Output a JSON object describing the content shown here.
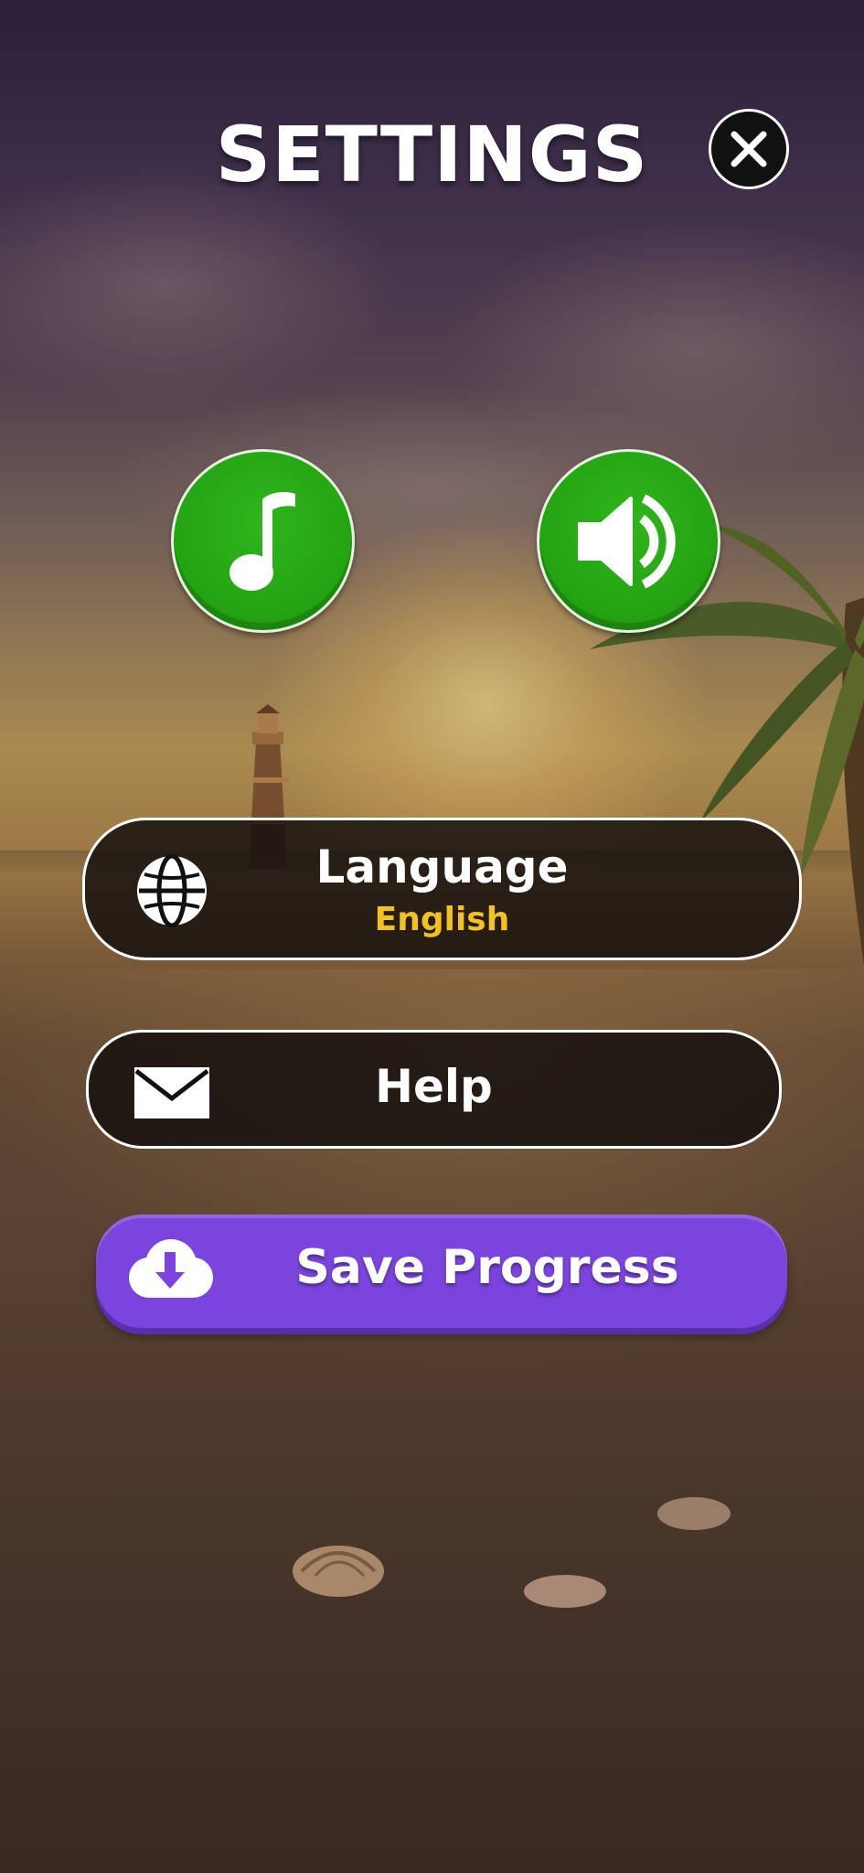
{
  "header": {
    "title": "SETTINGS"
  },
  "icons": {
    "close": "close-icon",
    "music": "music-note-icon",
    "sound": "speaker-icon",
    "language": "globe-icon",
    "help": "envelope-icon",
    "save": "cloud-download-icon"
  },
  "toggles": {
    "music": {
      "enabled": true
    },
    "sound": {
      "enabled": true
    }
  },
  "menu": {
    "language_label": "Language",
    "language_value": "English",
    "help_label": "Help",
    "save_label": "Save Progress"
  },
  "colors": {
    "toggle_on": "#24a412",
    "language_value": "#f2c21f",
    "save_button": "#7a44dd"
  }
}
